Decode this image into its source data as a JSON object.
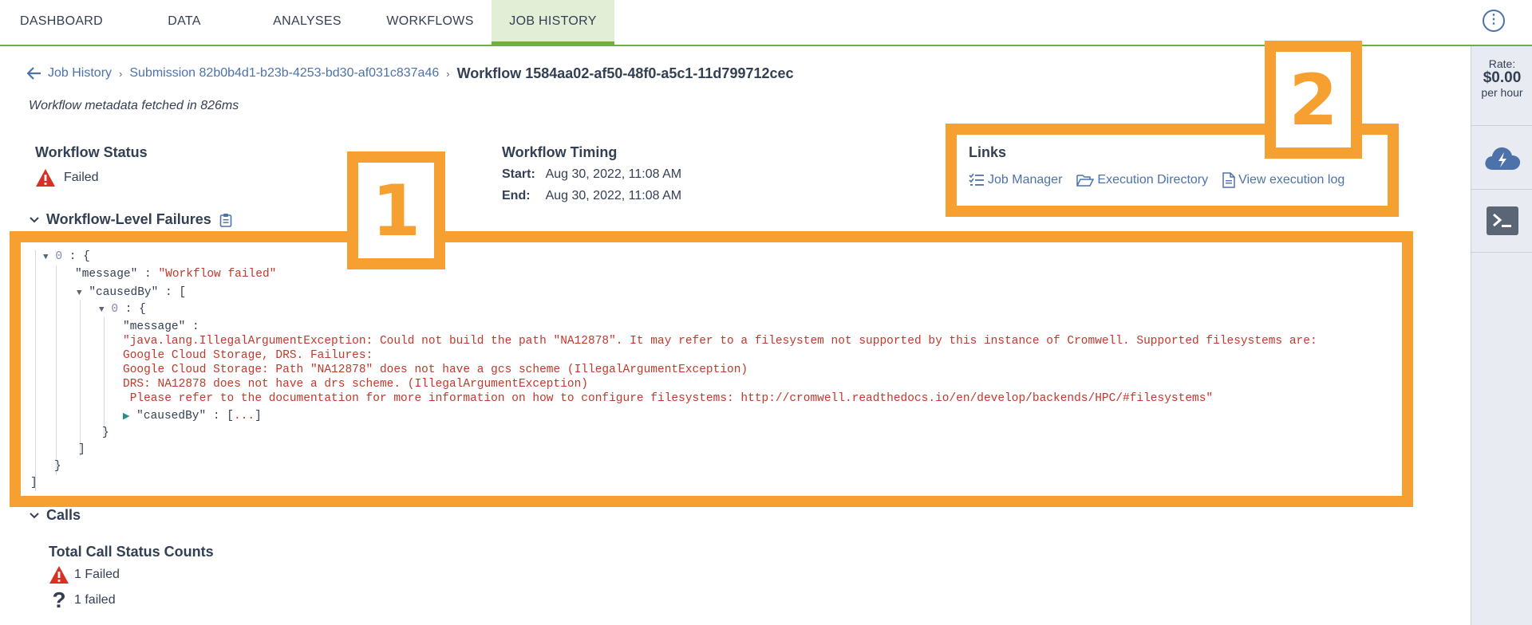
{
  "nav": {
    "tabs": [
      "DASHBOARD",
      "DATA",
      "ANALYSES",
      "WORKFLOWS",
      "JOB HISTORY"
    ],
    "active_tab": "JOB HISTORY"
  },
  "side_panel": {
    "rate_label": "Rate:",
    "rate_amount": "$0.00",
    "rate_unit": "per hour",
    "cloud_icon": "cloud-lightning-icon",
    "terminal_icon": "terminal-icon"
  },
  "breadcrumb": {
    "job_history": "Job History",
    "submission": "Submission 82b0b4d1-b23b-4253-bd30-af031c837a46",
    "workflow": "Workflow 1584aa02-af50-48f0-a5c1-11d799712cec"
  },
  "fetched_text": "Workflow metadata fetched in 826ms",
  "status": {
    "title": "Workflow Status",
    "value": "Failed"
  },
  "timing": {
    "title": "Workflow Timing",
    "start_label": "Start:",
    "start_value": "Aug 30, 2022, 11:08 AM",
    "end_label": "End:",
    "end_value": "Aug 30, 2022, 11:08 AM"
  },
  "links": {
    "title": "Links",
    "job_manager": "Job Manager",
    "execution_directory": "Execution Directory",
    "execution_log": "View execution log"
  },
  "failures": {
    "title": "Workflow-Level Failures",
    "index0": "0",
    "message_key": "\"message\"",
    "message_value": "\"Workflow failed\"",
    "caused_by_key": "\"causedBy\"",
    "inner_index": "0",
    "inner_message_key": "\"message\"",
    "inner_message_lines": [
      "\"java.lang.IllegalArgumentException: Could not build the path \"NA12878\". It may refer to a filesystem not supported by this instance of Cromwell. Supported filesystems are:",
      "Google Cloud Storage, DRS. Failures:",
      "Google Cloud Storage: Path \"NA12878\" does not have a gcs scheme (IllegalArgumentException)",
      "DRS: NA12878 does not have a drs scheme. (IllegalArgumentException)",
      " Please refer to the documentation for more information on how to configure filesystems: http://cromwell.readthedocs.io/en/develop/backends/HPC/#filesystems\""
    ],
    "collapsed_caused_by": "\"causedBy\"",
    "collapsed_ellipsis": "..."
  },
  "calls": {
    "title": "Calls",
    "counts_title": "Total Call Status Counts",
    "count1": "1 Failed",
    "count2": "1 failed"
  },
  "annotations": {
    "label1": "1",
    "label2": "2",
    "color": "#f6a032"
  },
  "colors": {
    "accent_green": "#74ae43",
    "link_blue": "#4d72aa",
    "json_string_red": "#c0392b",
    "warning_red": "#d93025"
  }
}
